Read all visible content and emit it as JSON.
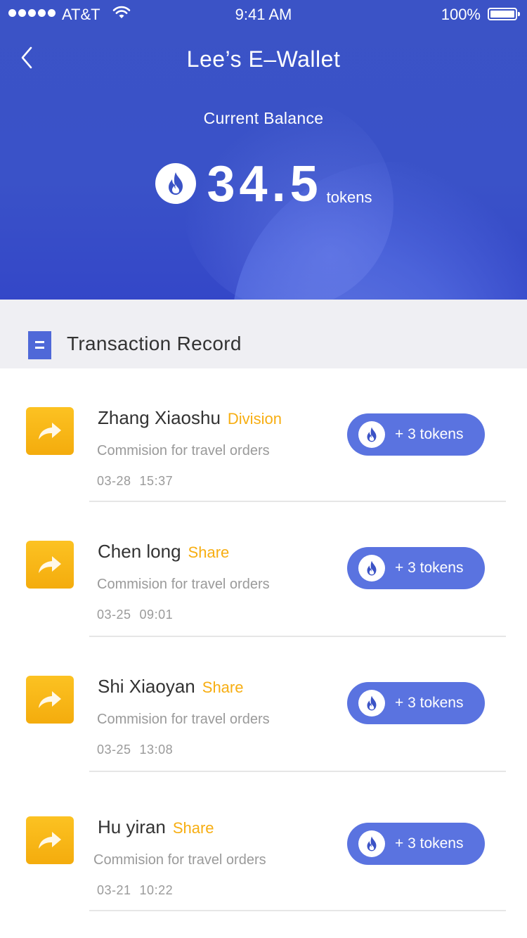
{
  "status_bar": {
    "carrier": "AT&T",
    "time": "9:41 AM",
    "battery": "100%"
  },
  "header": {
    "title": "Lee’s E–Wallet",
    "back_icon": "chevron-left-icon",
    "balance_label": "Current Balance",
    "balance_amount": "34.5",
    "balance_unit": "tokens",
    "token_icon": "flame-icon"
  },
  "records": {
    "section_title": "Transaction Record",
    "items": [
      {
        "name": "Zhang Xiaoshu",
        "tag": "Division",
        "description": "Commision for travel orders",
        "date": "03-28",
        "time": "15:37",
        "amount": "+ 3 tokens"
      },
      {
        "name": "Chen long",
        "tag": "Share",
        "description": "Commision for travel orders",
        "date": "03-25",
        "time": "09:01",
        "amount": "+ 3 tokens"
      },
      {
        "name": "Shi Xiaoyan",
        "tag": "Share",
        "description": "Commision for travel orders",
        "date": "03-25",
        "time": "13:08",
        "amount": "+ 3 tokens"
      },
      {
        "name": "Hu yiran",
        "tag": "Share",
        "description": "Commision for travel orders",
        "date": "03-21",
        "time": "10:22",
        "amount": "+ 3 tokens"
      }
    ]
  },
  "colors": {
    "header_blue": "#3b53c6",
    "pill_blue": "#5a73e0",
    "tag_orange": "#f7ae12",
    "avatar_yellow": "#fcc222"
  }
}
